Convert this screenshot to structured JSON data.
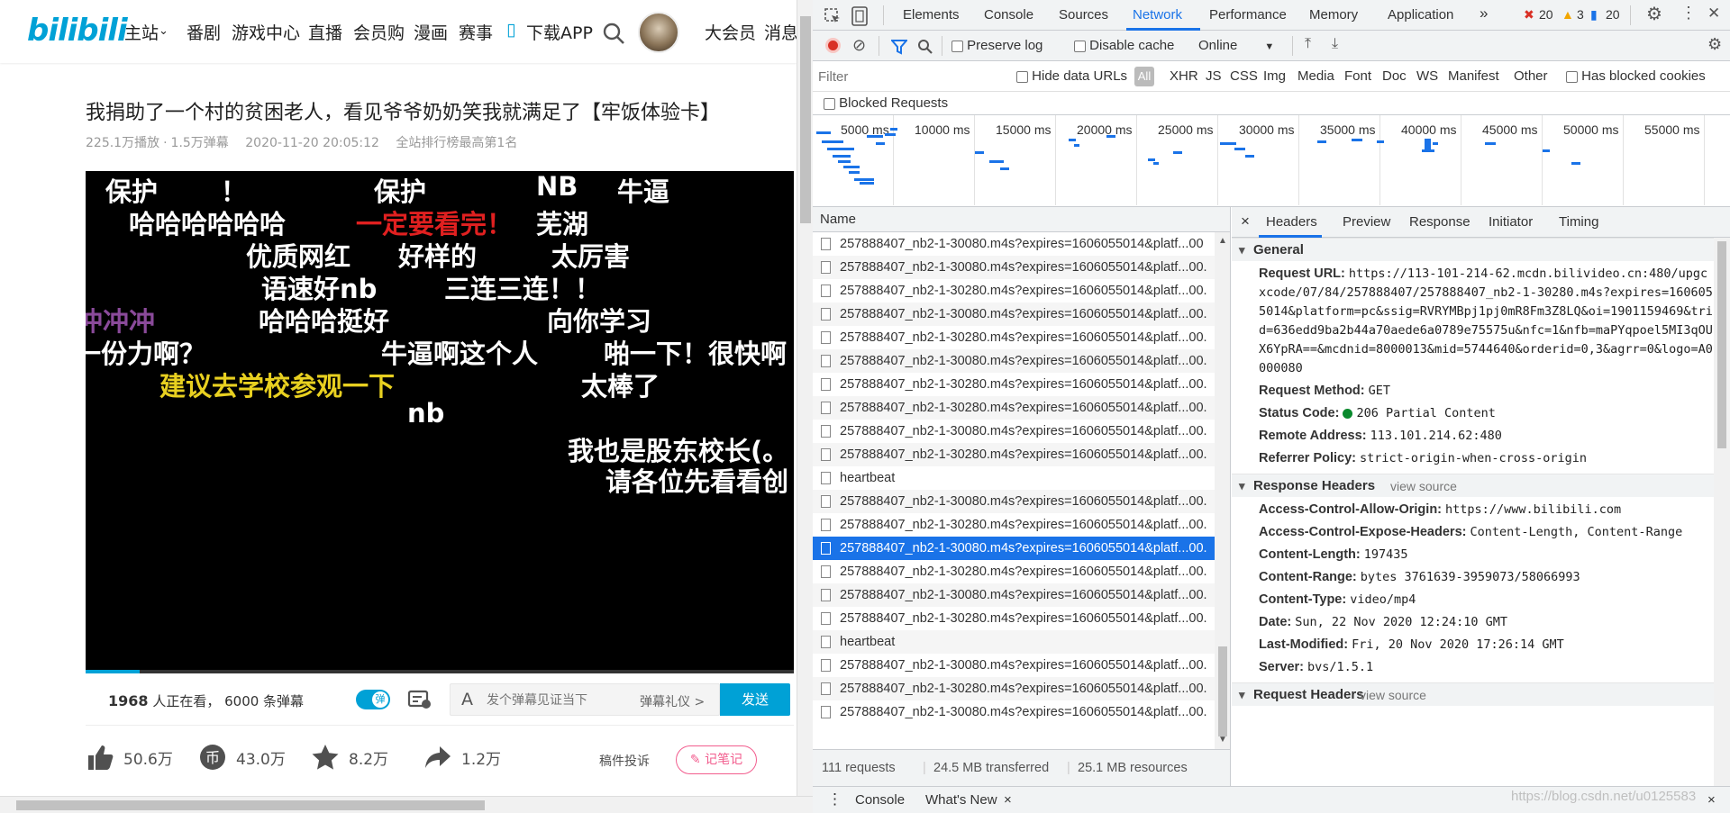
{
  "bili": {
    "logo": "bilibili",
    "nav": [
      "主站",
      "番剧",
      "游戏中心",
      "直播",
      "会员购",
      "漫画",
      "赛事",
      "下载APP",
      "大会员",
      "消息"
    ],
    "title": "我捐助了一个村的贫困老人，看见爷爷奶奶笑我就满足了【牢饭体验卡】",
    "meta": {
      "plays": "225.1万播放",
      "danmaku": "1.5万弹幕",
      "time": "2020-11-20 20:05:12",
      "rank": "全站排行榜最高第1名"
    },
    "danmaku": [
      {
        "t": "保护",
        "c": "#ffffff"
      },
      {
        "t": "！",
        "c": "#ffffff"
      },
      {
        "t": "保护",
        "c": "#ffffff"
      },
      {
        "t": "NB",
        "c": "#ffffff"
      },
      {
        "t": "牛逼",
        "c": "#ffffff"
      },
      {
        "t": "哈哈哈哈哈哈",
        "c": "#ffffff"
      },
      {
        "t": "一定要看完！",
        "c": "#e02020"
      },
      {
        "t": "芜湖",
        "c": "#ffffff"
      },
      {
        "t": "优质网红",
        "c": "#ffffff"
      },
      {
        "t": "好样的",
        "c": "#ffffff"
      },
      {
        "t": "太厉害",
        "c": "#ffffff"
      },
      {
        "t": "语速好nb",
        "c": "#ffffff"
      },
      {
        "t": "三连三连！！",
        "c": "#ffffff"
      },
      {
        "t": "冲冲冲",
        "c": "#8a4a9a"
      },
      {
        "t": "哈哈哈挺好",
        "c": "#ffffff"
      },
      {
        "t": "向你学习",
        "c": "#ffffff"
      },
      {
        "t": "一份力啊？",
        "c": "#ffffff"
      },
      {
        "t": "牛逼啊这个人",
        "c": "#ffffff"
      },
      {
        "t": "啪一下！很快啊",
        "c": "#ffffff"
      },
      {
        "t": "建议去学校参观一下",
        "c": "#e8d020"
      },
      {
        "t": "太棒了",
        "c": "#ffffff"
      },
      {
        "t": "nb",
        "c": "#ffffff"
      },
      {
        "t": "我也是股东校长(。",
        "c": "#ffffff"
      },
      {
        "t": "请各位先看看创",
        "c": "#ffffff"
      }
    ],
    "dmbar": {
      "count": "1968",
      "watching": "人正在看，",
      "dm_count": "6000 条弹幕",
      "toggle": "弹",
      "placeholder": "发个弹幕见证当下",
      "etiquette": "弹幕礼仪 >",
      "send": "发送"
    },
    "actions": {
      "like": "50.6万",
      "coin": "43.0万",
      "fav": "8.2万",
      "share": "1.2万",
      "report": "稿件投诉",
      "note": "记笔记"
    }
  },
  "devtools": {
    "tabs": [
      "Elements",
      "Console",
      "Sources",
      "Network",
      "Performance",
      "Memory",
      "Application",
      "»"
    ],
    "errors": "20",
    "warnings": "3",
    "messages": "20",
    "toolbar": {
      "preserve": "Preserve log",
      "cache": "Disable cache",
      "throttle": "Online"
    },
    "filter": {
      "placeholder": "Filter",
      "hide": "Hide data URLs",
      "all": "All",
      "types": [
        "XHR",
        "JS",
        "CSS",
        "Img",
        "Media",
        "Font",
        "Doc",
        "WS",
        "Manifest",
        "Other"
      ],
      "blocked_cookies": "Has blocked cookies",
      "blocked_req": "Blocked Requests"
    },
    "timeline": [
      "5000 ms",
      "10000 ms",
      "15000 ms",
      "20000 ms",
      "25000 ms",
      "30000 ms",
      "35000 ms",
      "40000 ms",
      "45000 ms",
      "50000 ms",
      "55000 ms"
    ],
    "list_header": "Name",
    "rows": [
      "257888407_nb2-1-30080.m4s?expires=1606055014&platf...00",
      "257888407_nb2-1-30080.m4s?expires=1606055014&platf...00.",
      "257888407_nb2-1-30280.m4s?expires=1606055014&platf...00.",
      "257888407_nb2-1-30080.m4s?expires=1606055014&platf...00.",
      "257888407_nb2-1-30280.m4s?expires=1606055014&platf...00.",
      "257888407_nb2-1-30080.m4s?expires=1606055014&platf...00.",
      "257888407_nb2-1-30280.m4s?expires=1606055014&platf...00.",
      "257888407_nb2-1-30280.m4s?expires=1606055014&platf...00.",
      "257888407_nb2-1-30080.m4s?expires=1606055014&platf...00.",
      "257888407_nb2-1-30280.m4s?expires=1606055014&platf...00.",
      "heartbeat",
      "257888407_nb2-1-30080.m4s?expires=1606055014&platf...00.",
      "257888407_nb2-1-30280.m4s?expires=1606055014&platf...00.",
      "257888407_nb2-1-30080.m4s?expires=1606055014&platf...00.",
      "257888407_nb2-1-30280.m4s?expires=1606055014&platf...00.",
      "257888407_nb2-1-30080.m4s?expires=1606055014&platf...00.",
      "257888407_nb2-1-30280.m4s?expires=1606055014&platf...00.",
      "heartbeat",
      "257888407_nb2-1-30080.m4s?expires=1606055014&platf...00.",
      "257888407_nb2-1-30280.m4s?expires=1606055014&platf...00.",
      "257888407_nb2-1-30080.m4s?expires=1606055014&platf...00."
    ],
    "selected_row": 13,
    "detail_tabs": [
      "×",
      "Headers",
      "Preview",
      "Response",
      "Initiator",
      "Timing"
    ],
    "general_title": "General",
    "general": [
      {
        "k": "Request URL:",
        "v": "https://113-101-214-62.mcdn.bilivideo.cn:480/upgcxcode/07/84/257888407/257888407_nb2-1-30280.m4s?expires=1606055014&platform=pc&ssig=RVRYMBpj1pj0mR8Fm3Z8LQ&oi=1901159469&trid=636edd9ba2b44a70aede6a0789e75575u&nfc=1&nfb=maPYqpoel5MI3qOUX6YpRA==&mcdnid=8000013&mid=5744640&orderid=0,3&agrr=0&logo=A0000080"
      },
      {
        "k": "Request Method:",
        "v": "GET"
      },
      {
        "k": "Status Code:",
        "v": "206 Partial Content"
      },
      {
        "k": "Remote Address:",
        "v": "113.101.214.62:480"
      },
      {
        "k": "Referrer Policy:",
        "v": "strict-origin-when-cross-origin"
      }
    ],
    "resp_title": "Response Headers",
    "view_source": "view source",
    "response": [
      {
        "k": "Access-Control-Allow-Origin:",
        "v": "https://www.bilibili.com"
      },
      {
        "k": "Access-Control-Expose-Headers:",
        "v": "Content-Length, Content-Range"
      },
      {
        "k": "Content-Length:",
        "v": "197435"
      },
      {
        "k": "Content-Range:",
        "v": "bytes 3761639-3959073/58066993"
      },
      {
        "k": "Content-Type:",
        "v": "video/mp4"
      },
      {
        "k": "Date:",
        "v": "Sun, 22 Nov 2020 12:24:10 GMT"
      },
      {
        "k": "Last-Modified:",
        "v": "Fri, 20 Nov 2020 17:26:14 GMT"
      },
      {
        "k": "Server:",
        "v": "bvs/1.5.1"
      }
    ],
    "req_title": "Request Headers",
    "status": {
      "requests": "111 requests",
      "transferred": "24.5 MB transferred",
      "resources": "25.1 MB resources"
    },
    "drawer": {
      "console": "Console",
      "whatsnew": "What's New",
      "close": "×"
    },
    "watermark": "https://blog.csdn.net/u0125583"
  }
}
